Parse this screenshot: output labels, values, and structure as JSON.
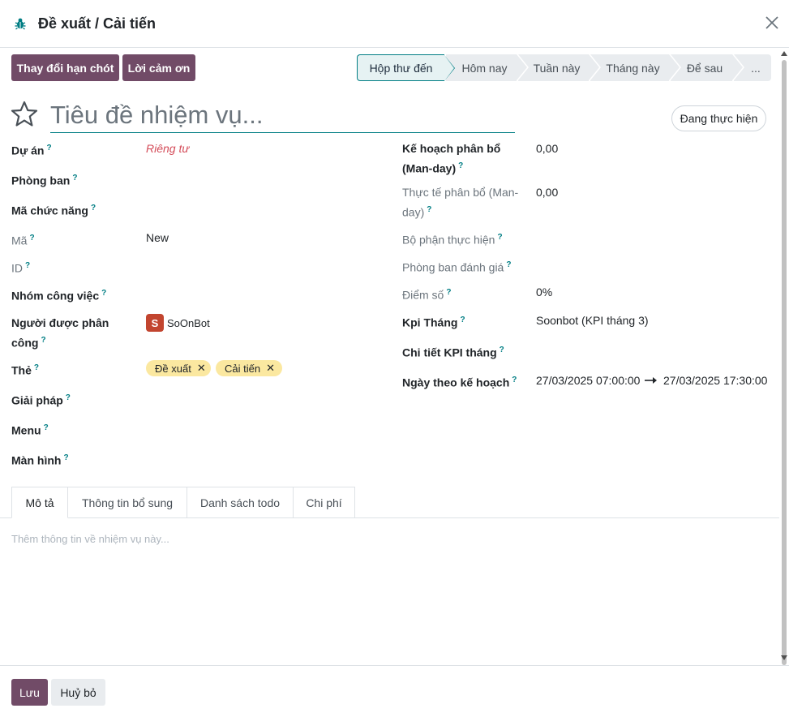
{
  "dialog": {
    "title": "Đề xuất / Cải tiến",
    "icon": "bug-icon",
    "accent_color": "#017e84",
    "brand_color": "#714b67"
  },
  "actions": {
    "change_deadline": "Thay đổi hạn chót",
    "thanks": "Lời cảm ơn"
  },
  "stages": [
    {
      "label": "Hộp thư đến",
      "active": true
    },
    {
      "label": "Hôm nay",
      "active": false
    },
    {
      "label": "Tuần này",
      "active": false
    },
    {
      "label": "Tháng này",
      "active": false
    },
    {
      "label": "Để sau",
      "active": false
    },
    {
      "label": "...",
      "active": false
    }
  ],
  "task": {
    "title_placeholder": "Tiêu đề nhiệm vụ...",
    "state": "Đang thực hiện",
    "starred": false
  },
  "left_fields": {
    "project_label": "Dự án",
    "project_value": "Riêng tư",
    "department_label": "Phòng ban",
    "function_code_label": "Mã chức năng",
    "code_label": "Mã",
    "code_value": "New",
    "id_label": "ID",
    "work_group_label": "Nhóm công việc",
    "assignee_label_1": "Người được phân",
    "assignee_label_2": "công",
    "assignee_initial": "S",
    "assignee_name": "SoOnBot",
    "tags_label": "Thẻ",
    "tags": [
      "Đề xuất",
      "Cải tiến"
    ],
    "tag_color": "#fbe8a0",
    "solution_label": "Giải pháp",
    "menu_label": "Menu",
    "screen_label": "Màn hình"
  },
  "right_fields": {
    "planned_alloc_label_1": "Kế hoạch phân bổ",
    "planned_alloc_label_2": "(Man-day)",
    "planned_alloc_value": "0,00",
    "actual_alloc_label_1": "Thực tế phân bổ (Man-",
    "actual_alloc_label_2": "day)",
    "actual_alloc_value": "0,00",
    "exec_unit_label": "Bộ phận thực hiện",
    "eval_dept_label": "Phòng ban đánh giá",
    "score_label": "Điểm số",
    "score_value": "0%",
    "kpi_month_label": "Kpi Tháng",
    "kpi_month_value": "Soonbot (KPI tháng 3)",
    "kpi_detail_label": "Chi tiết KPI tháng",
    "planned_date_label": "Ngày theo kế hoạch",
    "planned_date_start": "27/03/2025 07:00:00",
    "planned_date_end": "27/03/2025 17:30:00"
  },
  "tabs": [
    {
      "label": "Mô tả",
      "active": true
    },
    {
      "label": "Thông tin bổ sung",
      "active": false
    },
    {
      "label": "Danh sách todo",
      "active": false
    },
    {
      "label": "Chi phí",
      "active": false
    }
  ],
  "description_placeholder": "Thêm thông tin về nhiệm vụ này...",
  "footer": {
    "save": "Lưu",
    "cancel": "Huỷ bỏ"
  }
}
